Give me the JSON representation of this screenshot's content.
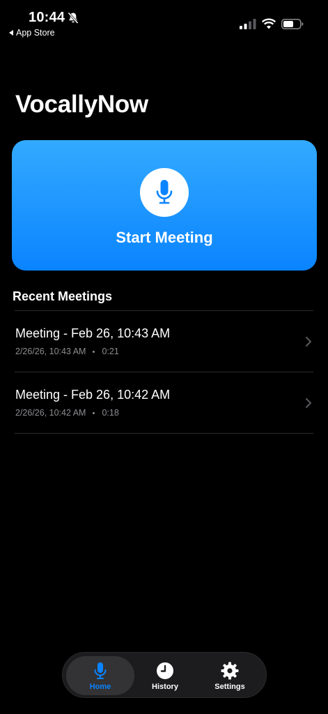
{
  "status_bar": {
    "time": "10:44",
    "back_app": "App Store"
  },
  "app": {
    "title": "VocallyNow"
  },
  "start_card": {
    "label": "Start Meeting",
    "accent_top": "#33aaff",
    "accent_bottom": "#0a84ff",
    "icon": "microphone-icon"
  },
  "recent": {
    "title": "Recent Meetings",
    "meetings": [
      {
        "title": "Meeting - Feb 26, 10:43 AM",
        "date": "2/26/26, 10:43 AM",
        "duration": "0:21"
      },
      {
        "title": "Meeting - Feb 26, 10:42 AM",
        "date": "2/26/26, 10:42 AM",
        "duration": "0:18"
      }
    ]
  },
  "tab_bar": {
    "tabs": [
      {
        "label": "Home",
        "icon": "microphone-icon",
        "active": true
      },
      {
        "label": "History",
        "icon": "clock-icon",
        "active": false
      },
      {
        "label": "Settings",
        "icon": "gear-icon",
        "active": false
      }
    ],
    "active_color": "#0a84ff"
  }
}
